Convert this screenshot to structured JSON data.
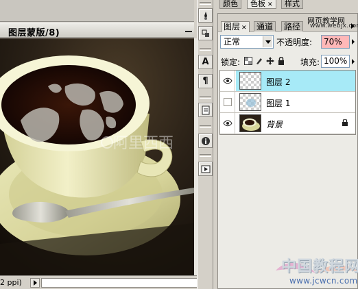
{
  "document": {
    "title": "图层蒙版/8)",
    "zoom": "2 ppi)",
    "canvas_watermark": "阿里西西"
  },
  "top_tabs": [
    {
      "label": "颜色",
      "closable": false,
      "active": false
    },
    {
      "label": "色板",
      "closable": true,
      "active": true
    },
    {
      "label": "样式",
      "closable": false,
      "active": false
    }
  ],
  "panel_tabs": [
    {
      "label": "图层",
      "closable": true,
      "active": true
    },
    {
      "label": "通道",
      "closable": false,
      "active": false
    },
    {
      "label": "路径",
      "closable": false,
      "active": false
    }
  ],
  "watermark": {
    "site_name": "网页教学网",
    "site_url": "www.webjx.com",
    "bottom_cn": "中国教程网",
    "bottom_url": "www.jcwcn.com"
  },
  "blend_mode": {
    "value": "正常"
  },
  "opacity": {
    "label": "不透明度:",
    "value": "70%"
  },
  "lock": {
    "label": "锁定:"
  },
  "fill": {
    "label": "填充:",
    "value": "100%"
  },
  "layers": [
    {
      "name": "图层 2",
      "visible": true,
      "selected": true,
      "locked": false,
      "italic": false
    },
    {
      "name": "图层 1",
      "visible": false,
      "selected": false,
      "locked": false,
      "italic": false
    },
    {
      "name": "背景",
      "visible": true,
      "selected": false,
      "locked": true,
      "italic": true
    }
  ],
  "tools": [
    {
      "icon": "brush-preset-icon"
    },
    {
      "icon": "clone-source-icon"
    },
    {
      "icon": "character-icon",
      "glyph": "A"
    },
    {
      "icon": "paragraph-icon",
      "glyph": "¶"
    },
    {
      "icon": "notes-icon"
    },
    {
      "icon": "info-icon"
    },
    {
      "icon": "actions-play-icon"
    }
  ],
  "colors": {
    "panel_bg": "#ecebe6",
    "selected_layer": "#a7eaf7",
    "opacity_field": "#ffb8b8",
    "chrome": "#d4d0c8"
  }
}
